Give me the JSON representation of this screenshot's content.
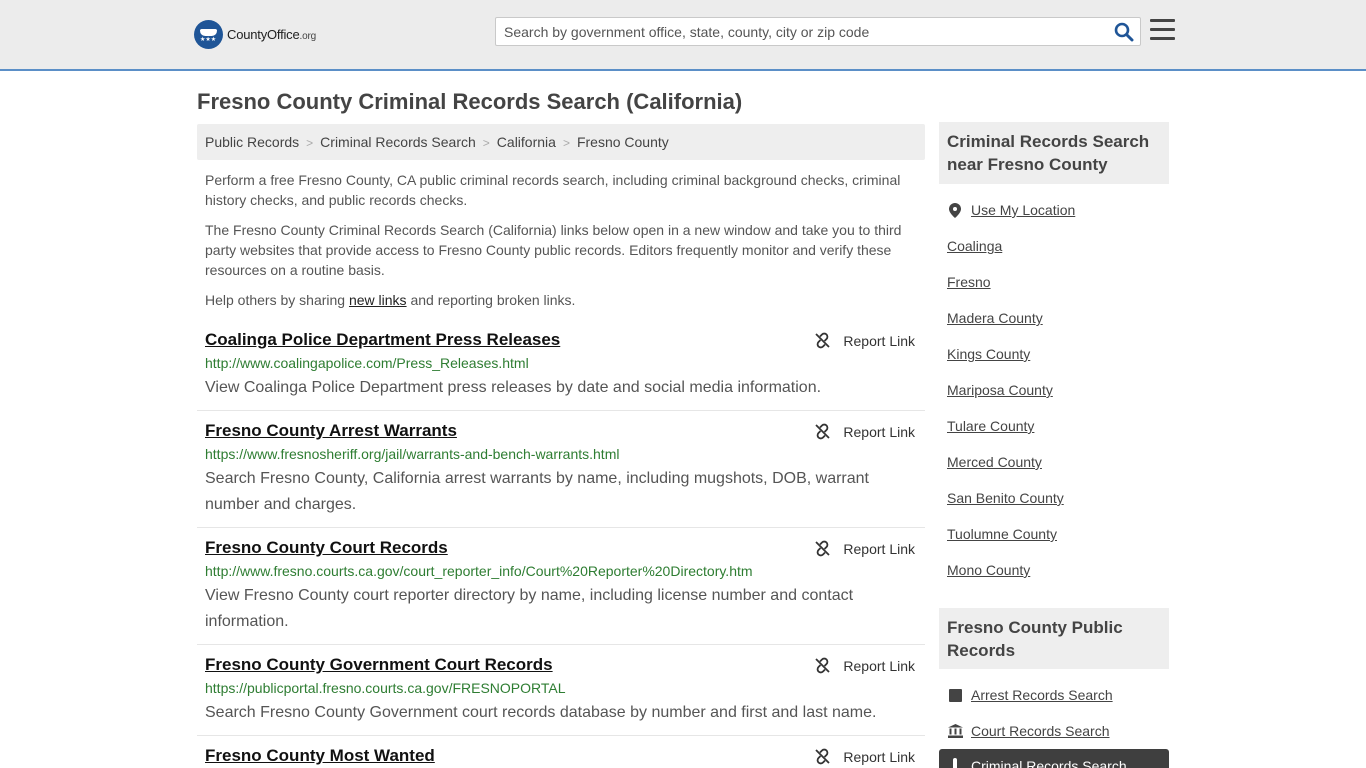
{
  "header": {
    "logo_main": "CountyOffice",
    "logo_suffix": ".org",
    "search_placeholder": "Search by government office, state, county, city or zip code"
  },
  "page_title": "Fresno County Criminal Records Search (California)",
  "breadcrumb": [
    "Public Records",
    "Criminal Records Search",
    "California",
    "Fresno County"
  ],
  "intro": {
    "p1": "Perform a free Fresno County, CA public criminal records search, including criminal background checks, criminal history checks, and public records checks.",
    "p2": "The Fresno County Criminal Records Search (California) links below open in a new window and take you to third party websites that provide access to Fresno County public records. Editors frequently monitor and verify these resources on a routine basis.",
    "p3_before": "Help others by sharing ",
    "p3_link": "new links",
    "p3_after": " and reporting broken links."
  },
  "report_label": "Report Link",
  "entries": [
    {
      "title": "Coalinga Police Department Press Releases",
      "url": "http://www.coalingapolice.com/Press_Releases.html",
      "desc": "View Coalinga Police Department press releases by date and social media information."
    },
    {
      "title": "Fresno County Arrest Warrants",
      "url": "https://www.fresnosheriff.org/jail/warrants-and-bench-warrants.html",
      "desc": "Search Fresno County, California arrest warrants by name, including mugshots, DOB, warrant number and charges."
    },
    {
      "title": "Fresno County Court Records",
      "url": "http://www.fresno.courts.ca.gov/court_reporter_info/Court%20Reporter%20Directory.htm",
      "desc": "View Fresno County court reporter directory by name, including license number and contact information."
    },
    {
      "title": "Fresno County Government Court Records",
      "url": "https://publicportal.fresno.courts.ca.gov/FRESNOPORTAL",
      "desc": "Search Fresno County Government court records database by number and first and last name."
    },
    {
      "title": "Fresno County Most Wanted",
      "url": "",
      "desc": ""
    }
  ],
  "sidebar": {
    "nearby_heading": "Criminal Records Search near Fresno County",
    "use_location": "Use My Location",
    "nearby": [
      "Coalinga",
      "Fresno",
      "Madera County",
      "Kings County",
      "Mariposa County",
      "Tulare County",
      "Merced County",
      "San Benito County",
      "Tuolumne County",
      "Mono County"
    ],
    "public_heading": "Fresno County Public Records",
    "public_links": [
      {
        "label": "Arrest Records Search",
        "icon": "square-icon"
      },
      {
        "label": "Court Records Search",
        "icon": "courthouse-icon"
      },
      {
        "label": "Criminal Records Search",
        "icon": "handcuffs-icon"
      }
    ]
  }
}
